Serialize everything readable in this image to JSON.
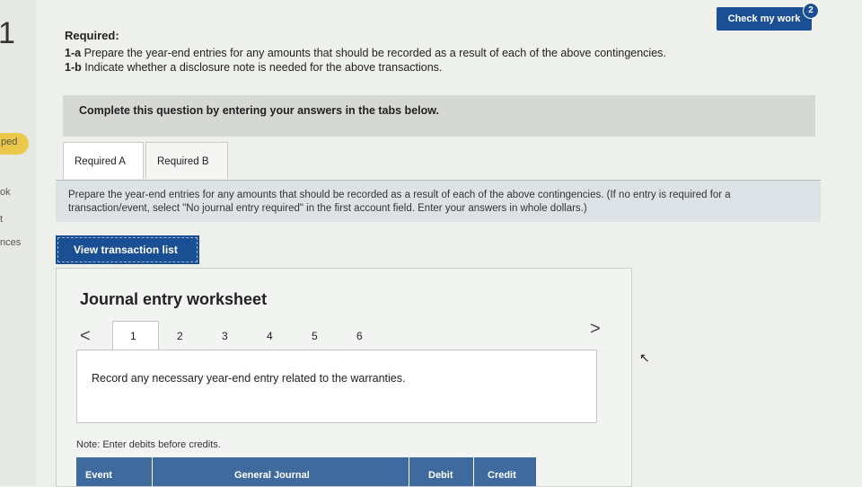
{
  "sidebar": {
    "question_number": "1",
    "items": [
      "ped",
      "ok",
      "t",
      "nces"
    ]
  },
  "header": {
    "check_button": "Check my work",
    "check_badge": "2"
  },
  "requirements": {
    "title": "Required:",
    "items": [
      {
        "id": "1-a",
        "text": "Prepare the year-end entries for any amounts that should be recorded as a result of each of the above contingencies."
      },
      {
        "id": "1-b",
        "text": "Indicate whether a disclosure note is needed for the above transactions."
      }
    ]
  },
  "instructions": "Complete this question by entering your answers in the tabs below.",
  "tabs": [
    {
      "label": "Required A"
    },
    {
      "label": "Required B"
    }
  ],
  "tab_panel_text": "Prepare the year-end entries for any amounts that should be recorded as a result of each of the above contingencies. (If no entry is required for a transaction/event, select \"No journal entry required\" in the first account field. Enter your answers in whole dollars.)",
  "view_button": "View transaction list",
  "worksheet": {
    "title": "Journal entry worksheet",
    "prev": "<",
    "next": ">",
    "pages": [
      "1",
      "2",
      "3",
      "4",
      "5",
      "6"
    ],
    "prompt": "Record any necessary year-end entry related to the warranties.",
    "note": "Note: Enter debits before credits.",
    "columns": [
      "Event",
      "General Journal",
      "Debit",
      "Credit"
    ]
  },
  "colors": {
    "primary": "#1b4f93",
    "highlight": "#e9c84a"
  }
}
